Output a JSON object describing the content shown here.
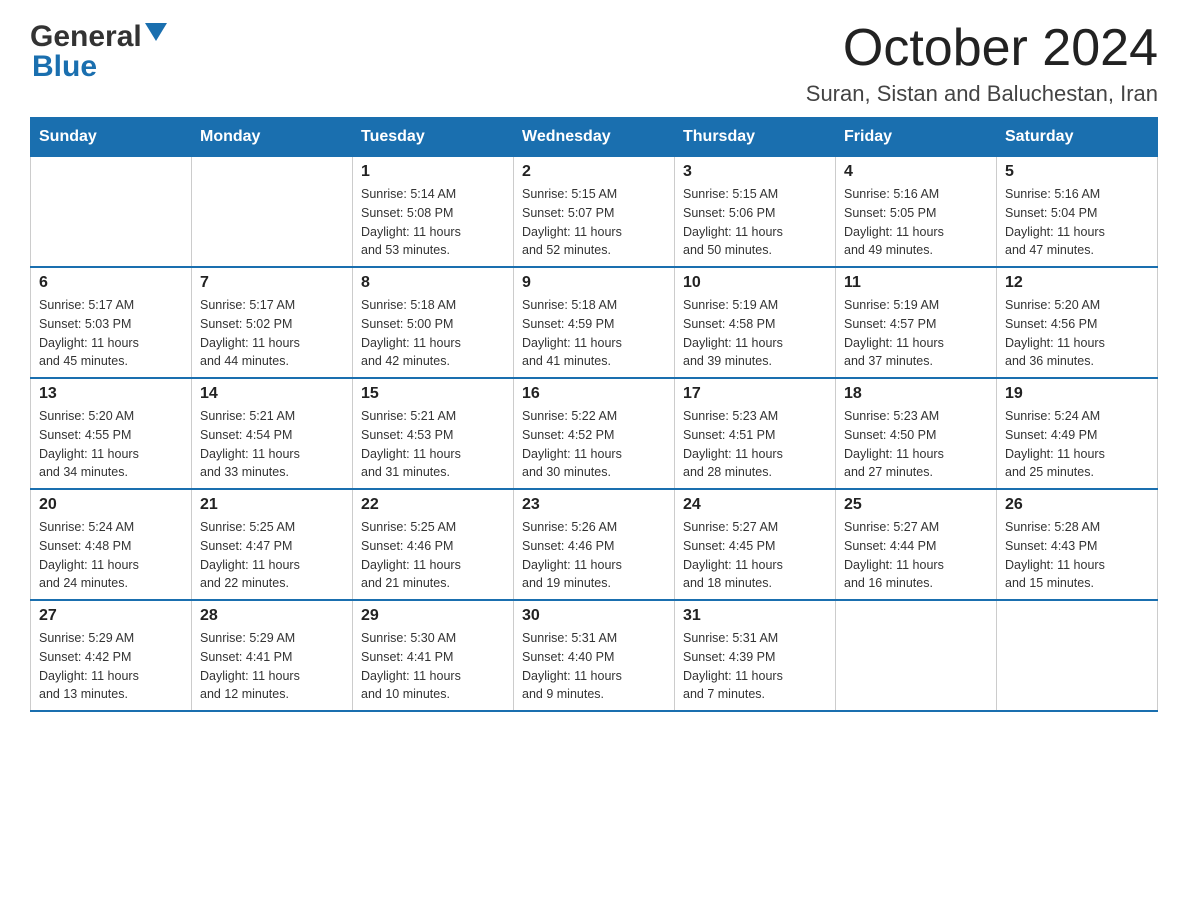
{
  "header": {
    "month_title": "October 2024",
    "location": "Suran, Sistan and Baluchestan, Iran"
  },
  "days_of_week": [
    "Sunday",
    "Monday",
    "Tuesday",
    "Wednesday",
    "Thursday",
    "Friday",
    "Saturday"
  ],
  "weeks": [
    [
      {
        "day": "",
        "info": ""
      },
      {
        "day": "",
        "info": ""
      },
      {
        "day": "1",
        "info": "Sunrise: 5:14 AM\nSunset: 5:08 PM\nDaylight: 11 hours\nand 53 minutes."
      },
      {
        "day": "2",
        "info": "Sunrise: 5:15 AM\nSunset: 5:07 PM\nDaylight: 11 hours\nand 52 minutes."
      },
      {
        "day": "3",
        "info": "Sunrise: 5:15 AM\nSunset: 5:06 PM\nDaylight: 11 hours\nand 50 minutes."
      },
      {
        "day": "4",
        "info": "Sunrise: 5:16 AM\nSunset: 5:05 PM\nDaylight: 11 hours\nand 49 minutes."
      },
      {
        "day": "5",
        "info": "Sunrise: 5:16 AM\nSunset: 5:04 PM\nDaylight: 11 hours\nand 47 minutes."
      }
    ],
    [
      {
        "day": "6",
        "info": "Sunrise: 5:17 AM\nSunset: 5:03 PM\nDaylight: 11 hours\nand 45 minutes."
      },
      {
        "day": "7",
        "info": "Sunrise: 5:17 AM\nSunset: 5:02 PM\nDaylight: 11 hours\nand 44 minutes."
      },
      {
        "day": "8",
        "info": "Sunrise: 5:18 AM\nSunset: 5:00 PM\nDaylight: 11 hours\nand 42 minutes."
      },
      {
        "day": "9",
        "info": "Sunrise: 5:18 AM\nSunset: 4:59 PM\nDaylight: 11 hours\nand 41 minutes."
      },
      {
        "day": "10",
        "info": "Sunrise: 5:19 AM\nSunset: 4:58 PM\nDaylight: 11 hours\nand 39 minutes."
      },
      {
        "day": "11",
        "info": "Sunrise: 5:19 AM\nSunset: 4:57 PM\nDaylight: 11 hours\nand 37 minutes."
      },
      {
        "day": "12",
        "info": "Sunrise: 5:20 AM\nSunset: 4:56 PM\nDaylight: 11 hours\nand 36 minutes."
      }
    ],
    [
      {
        "day": "13",
        "info": "Sunrise: 5:20 AM\nSunset: 4:55 PM\nDaylight: 11 hours\nand 34 minutes."
      },
      {
        "day": "14",
        "info": "Sunrise: 5:21 AM\nSunset: 4:54 PM\nDaylight: 11 hours\nand 33 minutes."
      },
      {
        "day": "15",
        "info": "Sunrise: 5:21 AM\nSunset: 4:53 PM\nDaylight: 11 hours\nand 31 minutes."
      },
      {
        "day": "16",
        "info": "Sunrise: 5:22 AM\nSunset: 4:52 PM\nDaylight: 11 hours\nand 30 minutes."
      },
      {
        "day": "17",
        "info": "Sunrise: 5:23 AM\nSunset: 4:51 PM\nDaylight: 11 hours\nand 28 minutes."
      },
      {
        "day": "18",
        "info": "Sunrise: 5:23 AM\nSunset: 4:50 PM\nDaylight: 11 hours\nand 27 minutes."
      },
      {
        "day": "19",
        "info": "Sunrise: 5:24 AM\nSunset: 4:49 PM\nDaylight: 11 hours\nand 25 minutes."
      }
    ],
    [
      {
        "day": "20",
        "info": "Sunrise: 5:24 AM\nSunset: 4:48 PM\nDaylight: 11 hours\nand 24 minutes."
      },
      {
        "day": "21",
        "info": "Sunrise: 5:25 AM\nSunset: 4:47 PM\nDaylight: 11 hours\nand 22 minutes."
      },
      {
        "day": "22",
        "info": "Sunrise: 5:25 AM\nSunset: 4:46 PM\nDaylight: 11 hours\nand 21 minutes."
      },
      {
        "day": "23",
        "info": "Sunrise: 5:26 AM\nSunset: 4:46 PM\nDaylight: 11 hours\nand 19 minutes."
      },
      {
        "day": "24",
        "info": "Sunrise: 5:27 AM\nSunset: 4:45 PM\nDaylight: 11 hours\nand 18 minutes."
      },
      {
        "day": "25",
        "info": "Sunrise: 5:27 AM\nSunset: 4:44 PM\nDaylight: 11 hours\nand 16 minutes."
      },
      {
        "day": "26",
        "info": "Sunrise: 5:28 AM\nSunset: 4:43 PM\nDaylight: 11 hours\nand 15 minutes."
      }
    ],
    [
      {
        "day": "27",
        "info": "Sunrise: 5:29 AM\nSunset: 4:42 PM\nDaylight: 11 hours\nand 13 minutes."
      },
      {
        "day": "28",
        "info": "Sunrise: 5:29 AM\nSunset: 4:41 PM\nDaylight: 11 hours\nand 12 minutes."
      },
      {
        "day": "29",
        "info": "Sunrise: 5:30 AM\nSunset: 4:41 PM\nDaylight: 11 hours\nand 10 minutes."
      },
      {
        "day": "30",
        "info": "Sunrise: 5:31 AM\nSunset: 4:40 PM\nDaylight: 11 hours\nand 9 minutes."
      },
      {
        "day": "31",
        "info": "Sunrise: 5:31 AM\nSunset: 4:39 PM\nDaylight: 11 hours\nand 7 minutes."
      },
      {
        "day": "",
        "info": ""
      },
      {
        "day": "",
        "info": ""
      }
    ]
  ]
}
